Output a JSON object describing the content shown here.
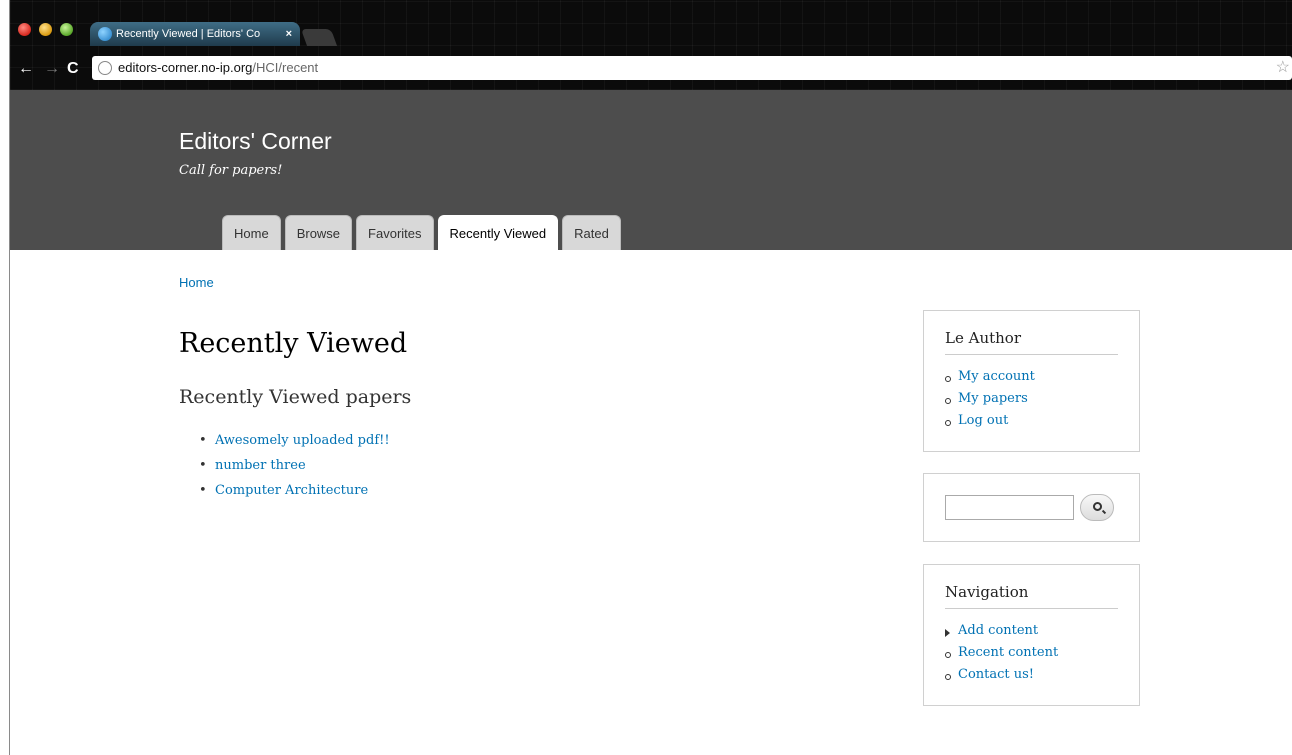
{
  "browser": {
    "tab_title": "Recently Viewed | Editors' Co",
    "tab_close": "×",
    "url_host": "editors-corner.no-ip.org",
    "url_path": "/HCI/recent"
  },
  "site": {
    "name": "Editors' Corner",
    "slogan": "Call for papers!",
    "tabs": [
      {
        "label": "Home"
      },
      {
        "label": "Browse"
      },
      {
        "label": "Favorites"
      },
      {
        "label": "Recently Viewed",
        "active": true
      },
      {
        "label": "Rated"
      }
    ]
  },
  "main": {
    "breadcrumb": "Home",
    "title": "Recently Viewed",
    "subtitle": "Recently Viewed papers",
    "papers": [
      {
        "label": "Awesomely uploaded pdf!!"
      },
      {
        "label": "number three"
      },
      {
        "label": "Computer Architecture"
      }
    ]
  },
  "sidebar": {
    "author": {
      "title": "Le Author",
      "links": [
        {
          "label": "My account"
        },
        {
          "label": "My papers"
        },
        {
          "label": "Log out"
        }
      ]
    },
    "search": {
      "value": "",
      "button_icon": "search-icon"
    },
    "navigation": {
      "title": "Navigation",
      "links": [
        {
          "label": "Add content"
        },
        {
          "label": "Recent content"
        },
        {
          "label": "Contact us!"
        }
      ]
    }
  },
  "colors": {
    "link": "#0071b3",
    "header_bg": "#4d4d4d",
    "chrome_bg": "#0b0b0b"
  }
}
